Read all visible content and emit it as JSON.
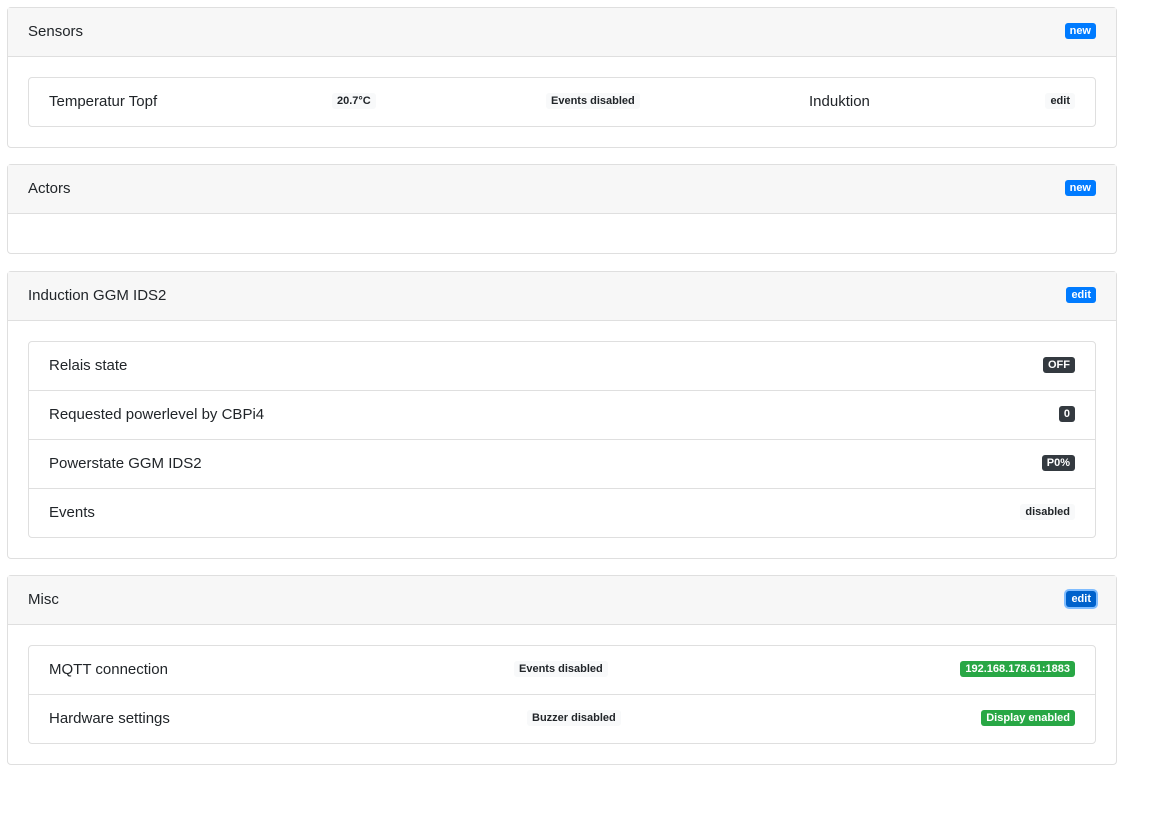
{
  "sensors": {
    "title": "Sensors",
    "new_label": "new",
    "items": [
      {
        "name": "Temperatur Topf",
        "value": "20.7°C",
        "events": "Events disabled",
        "actor": "Induktion",
        "edit_label": "edit"
      }
    ]
  },
  "actors": {
    "title": "Actors",
    "new_label": "new"
  },
  "induction": {
    "title": "Induction GGM IDS2",
    "edit_label": "edit",
    "rows": [
      {
        "label": "Relais state",
        "value": "OFF"
      },
      {
        "label": "Requested powerlevel by CBPi4",
        "value": "0"
      },
      {
        "label": "Powerstate GGM IDS2",
        "value": "P0%"
      },
      {
        "label": "Events",
        "value": "disabled"
      }
    ]
  },
  "misc": {
    "title": "Misc",
    "edit_label": "edit",
    "rows": [
      {
        "label": "MQTT connection",
        "middle": "Events disabled",
        "value": "192.168.178.61:1883"
      },
      {
        "label": "Hardware settings",
        "middle": "Buzzer disabled",
        "value": "Display enabled"
      }
    ]
  },
  "colors": {
    "primary": "#007bff",
    "success": "#28a745",
    "dark": "#343a40"
  }
}
